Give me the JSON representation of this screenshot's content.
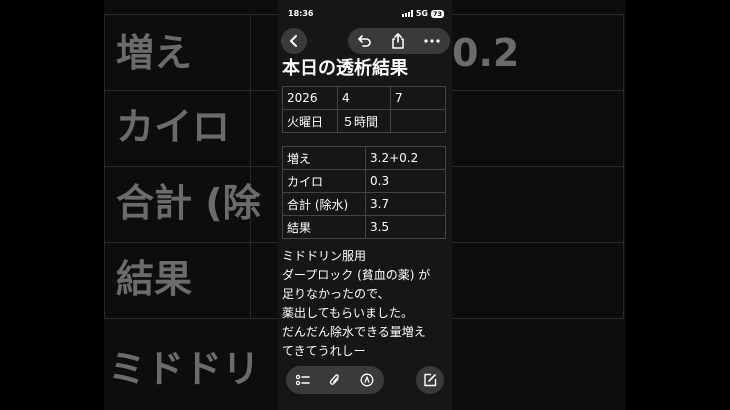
{
  "background": {
    "rows": [
      "増え",
      "カイロ",
      "合計 (除",
      "結果"
    ],
    "right_fragment": "0.2",
    "bottom_fragment": "ミドドリ"
  },
  "status": {
    "time": "18:36",
    "network": "5G",
    "battery": "73"
  },
  "toolbar": {
    "back_icon": "chevron-left-icon",
    "undo_icon": "undo-icon",
    "share_icon": "share-icon",
    "more_icon": "ellipsis-icon"
  },
  "note": {
    "title": "本日の透析結果",
    "date_table": [
      [
        "2026",
        "4",
        "7"
      ],
      [
        "火曜日",
        "５時間",
        ""
      ]
    ],
    "result_table": [
      [
        "増え",
        "3.2+0.2"
      ],
      [
        "カイロ",
        "0.3"
      ],
      [
        "合計 (除水)",
        "3.7"
      ],
      [
        "結果",
        "3.5"
      ]
    ],
    "lines": [
      "ミドドリン服用",
      "ダープロック (貧血の薬) が",
      "足りなかったので、",
      "薬出してもらいました。",
      "だんだん除水できる量増え",
      "てきてうれしー"
    ]
  },
  "bottom_toolbar": {
    "checklist_icon": "checklist-icon",
    "attach_icon": "paperclip-icon",
    "markup_icon": "pen-circle-icon",
    "compose_icon": "compose-icon"
  }
}
